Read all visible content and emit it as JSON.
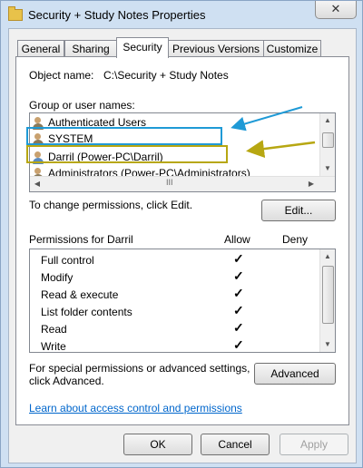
{
  "window": {
    "title": "Security + Study Notes Properties",
    "close_glyph": "✕"
  },
  "tabs": [
    {
      "label": "General"
    },
    {
      "label": "Sharing"
    },
    {
      "label": "Security",
      "active": true
    },
    {
      "label": "Previous Versions"
    },
    {
      "label": "Customize"
    }
  ],
  "object": {
    "label": "Object name:",
    "value": "C:\\Security + Study Notes"
  },
  "groups": {
    "label": "Group or user names:",
    "items": [
      {
        "name": "Authenticated Users",
        "icon": "users-icon"
      },
      {
        "name": "SYSTEM",
        "icon": "users-icon"
      },
      {
        "name": "Darril (Power-PC\\Darril)",
        "icon": "user-icon"
      },
      {
        "name": "Administrators (Power-PC\\Administrators)",
        "icon": "users-icon"
      }
    ],
    "hscroll_grip": "III"
  },
  "change_text": "To change permissions, click Edit.",
  "edit_button": "Edit...",
  "permissions": {
    "header_name": "Permissions for Darril",
    "header_allow": "Allow",
    "header_deny": "Deny",
    "rows": [
      {
        "name": "Full control",
        "allow": "✓"
      },
      {
        "name": "Modify",
        "allow": "✓"
      },
      {
        "name": "Read & execute",
        "allow": "✓"
      },
      {
        "name": "List folder contents",
        "allow": "✓"
      },
      {
        "name": "Read",
        "allow": "✓"
      },
      {
        "name": "Write",
        "allow": "✓"
      }
    ]
  },
  "special": {
    "line1": "For special permissions or advanced settings,",
    "line2": "click Advanced."
  },
  "advanced_button": "Advanced",
  "learn_link": "Learn about access control and permissions",
  "buttons": {
    "ok": "OK",
    "cancel": "Cancel",
    "apply": "Apply"
  },
  "annotations": {
    "blue": "#1f9ad6",
    "olive": "#b7a712"
  }
}
